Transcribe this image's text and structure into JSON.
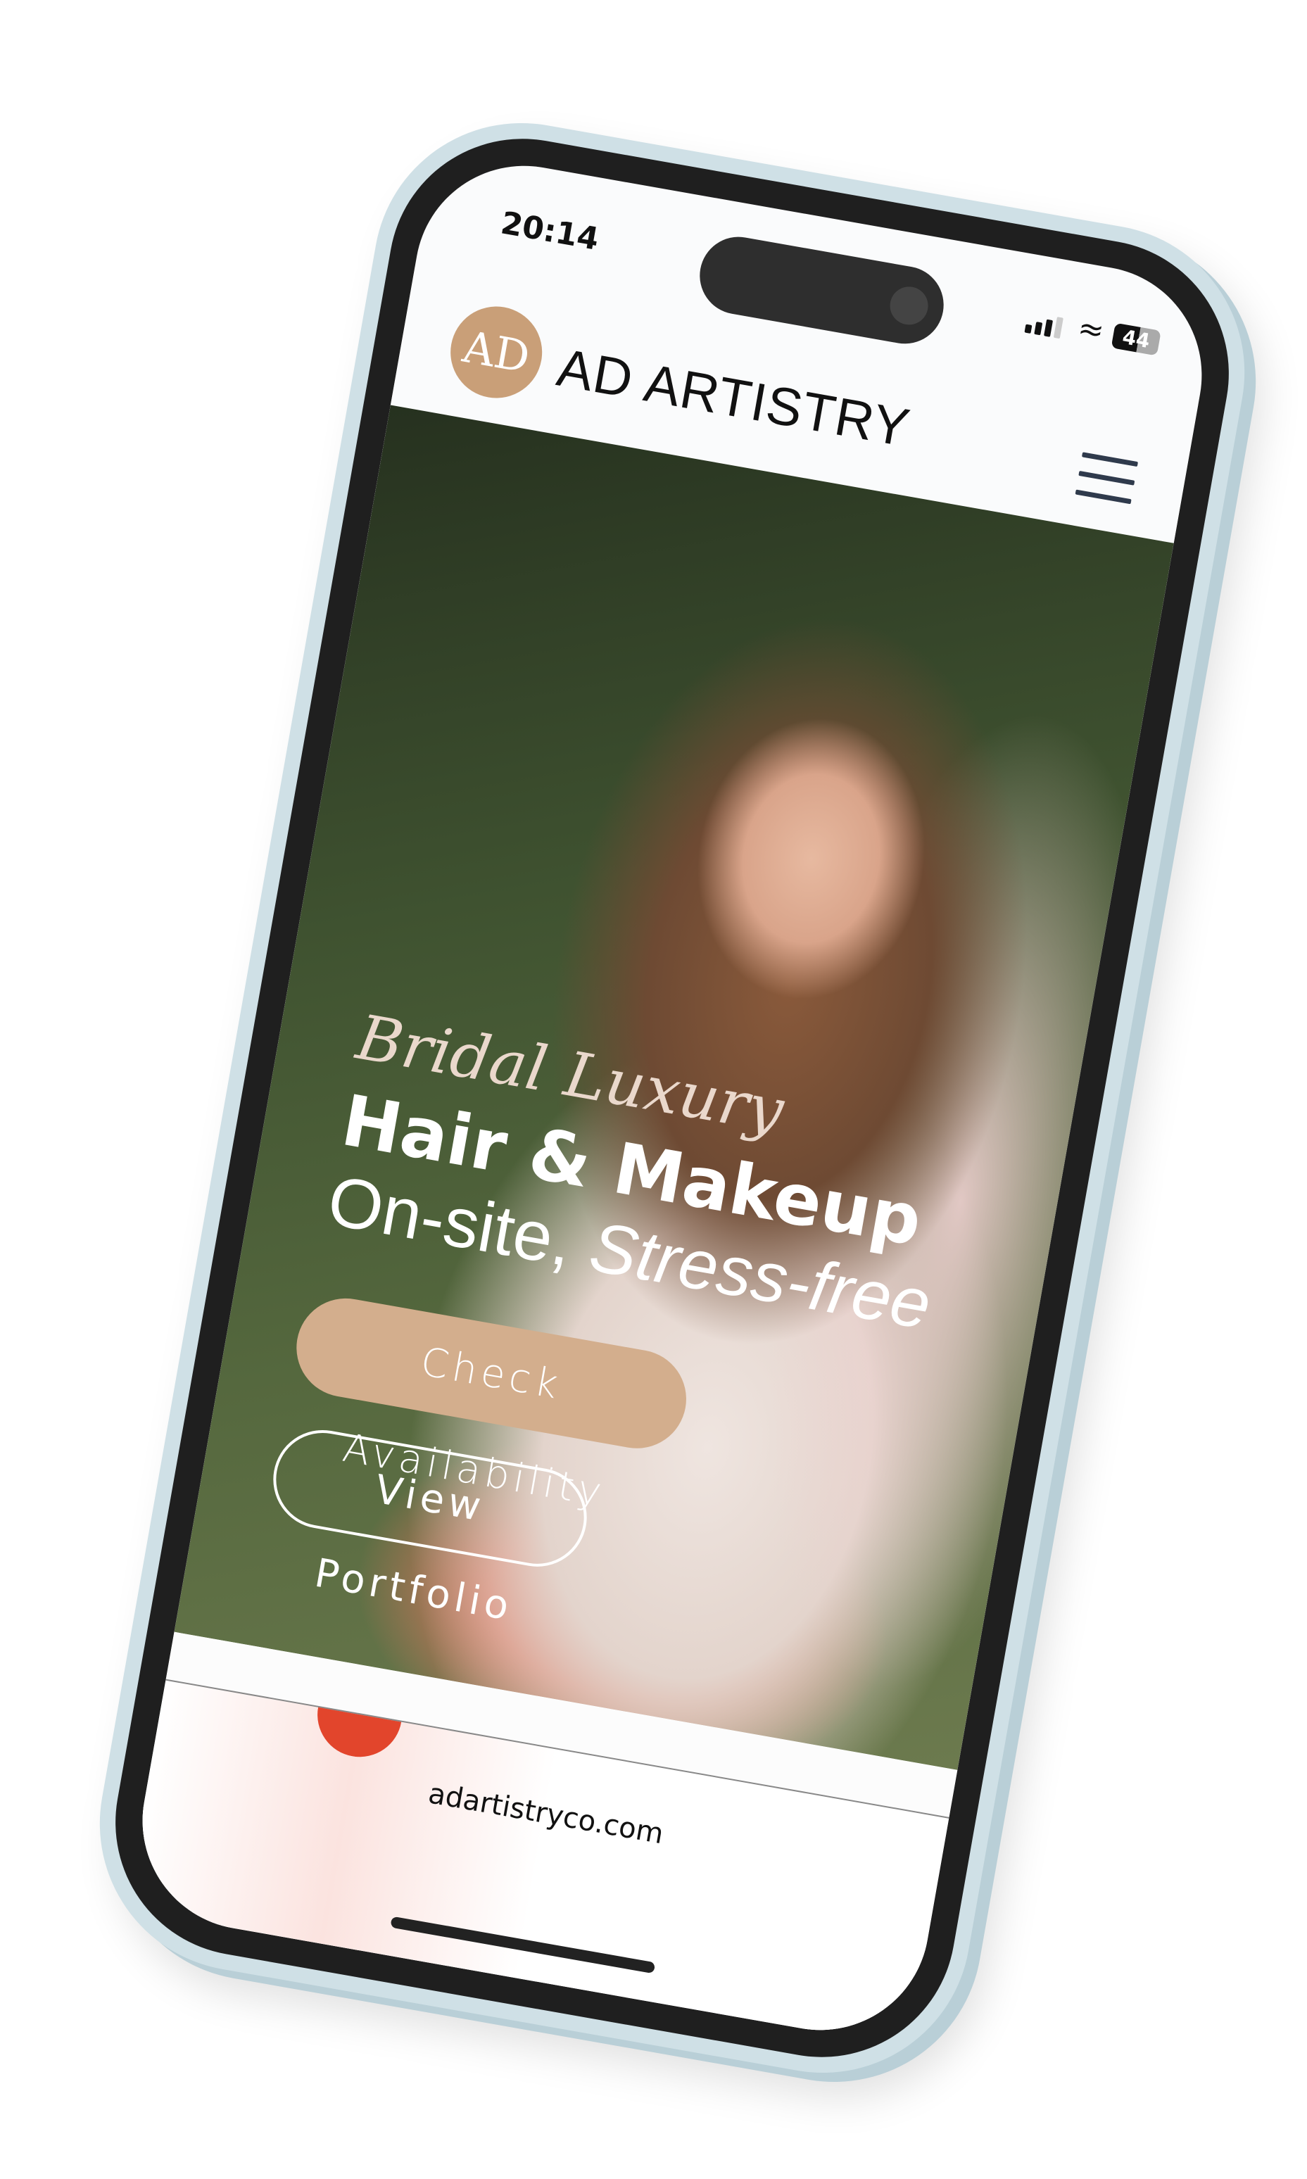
{
  "status_bar": {
    "time": "20:14",
    "battery": "44"
  },
  "header": {
    "logo_text": "AD",
    "brand": "AD ARTISTRY"
  },
  "hero": {
    "script_title": "Bridal Luxury",
    "headline": "Hair & Makeup",
    "subline_plain": "On-site, ",
    "subline_italic": "Stress-free",
    "primary_button": "Check Availability",
    "secondary_button": "View Portfolio"
  },
  "browser": {
    "url": "adartistryco.com"
  },
  "colors": {
    "accent": "#d3ae8d",
    "logo": "#c99f78",
    "frame": "#cfe0e6"
  }
}
